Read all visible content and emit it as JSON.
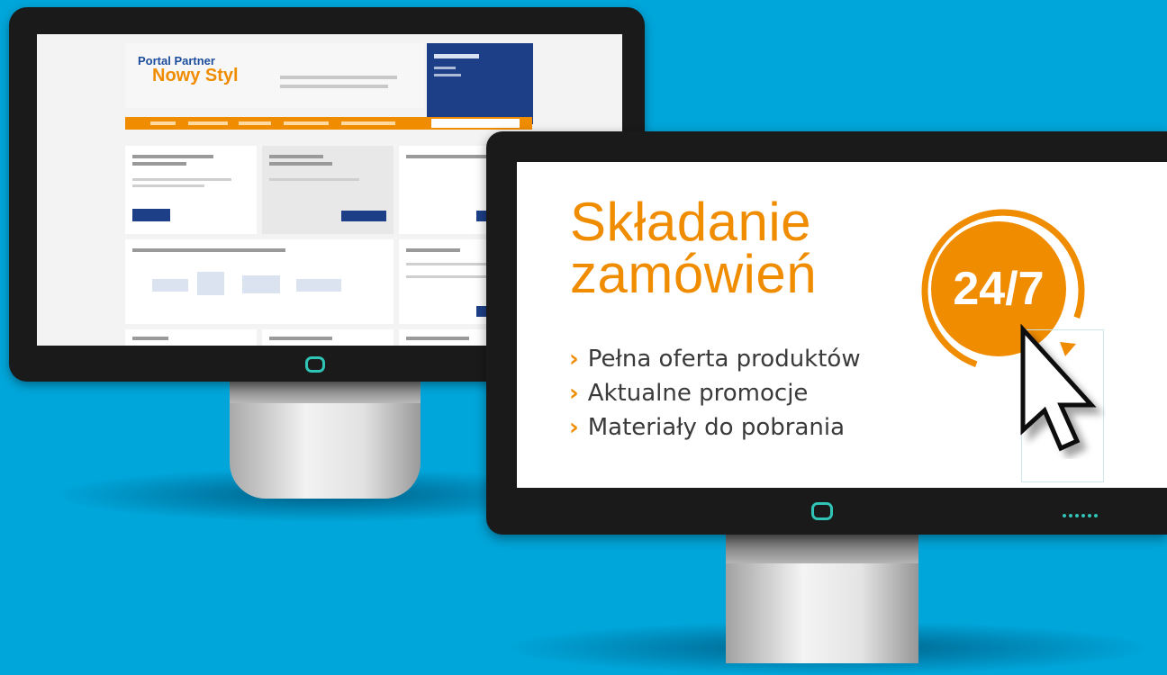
{
  "back_screen": {
    "brand_line1": "Portal Partner",
    "brand_line2": "Nowy Styl"
  },
  "front_screen": {
    "headline_line1": "Składanie",
    "headline_line2": "zamówień",
    "badge": "24/7",
    "features": [
      "Pełna oferta produktów",
      "Aktualne promocje",
      "Materiały do pobrania"
    ],
    "bullet_glyph": "›"
  },
  "colors": {
    "background": "#00a5d9",
    "accent_orange": "#f08c00",
    "navy": "#1c3f87",
    "led_teal": "#2fc4b6"
  },
  "icons": [
    "power-button-icon",
    "cursor-icon",
    "refresh-arrow-icon"
  ]
}
